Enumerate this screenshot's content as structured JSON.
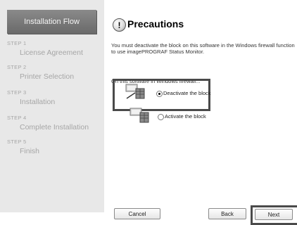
{
  "sidebar": {
    "header": "Installation Flow",
    "steps": [
      {
        "num": "STEP 1",
        "name": "License Agreement"
      },
      {
        "num": "STEP 2",
        "name": "Printer Selection"
      },
      {
        "num": "STEP 3",
        "name": "Installation"
      },
      {
        "num": "STEP 4",
        "name": "Complete Installation"
      },
      {
        "num": "STEP 5",
        "name": "Finish"
      }
    ]
  },
  "main": {
    "title": "Precautions",
    "title_icon_glyph": "!",
    "message": "You must deactivate the block on this software in the Windows firewall function to use imagePROGRAF Status Monitor.",
    "subheading": "On this software in Windows firewall...",
    "options": [
      {
        "label": "Deactivate the block",
        "checked": true
      },
      {
        "label": "Activate the block",
        "checked": false
      }
    ]
  },
  "buttons": {
    "cancel": "Cancel",
    "back": "Back",
    "next": "Next"
  }
}
